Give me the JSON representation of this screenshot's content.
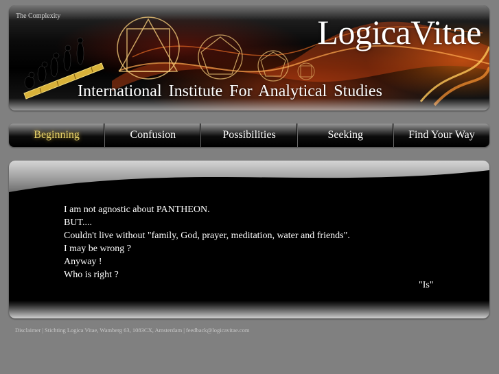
{
  "header": {
    "tagline": "The Complexity",
    "brand": "LogicaVitae",
    "institute": "International  Institute  For  Analytical  Studies"
  },
  "nav": {
    "items": [
      {
        "label": "Beginning",
        "active": true
      },
      {
        "label": "Confusion",
        "active": false
      },
      {
        "label": "Possibilities",
        "active": false
      },
      {
        "label": "Seeking",
        "active": false
      },
      {
        "label": "Find Your Way",
        "active": false
      }
    ]
  },
  "content": {
    "lines": [
      "I am not agnostic about PANTHEON.",
      "BUT....",
      "Couldn't live without \"family, God, prayer, meditation, water and friends\".",
      "I may be wrong ?",
      "Anyway !",
      "Who is right ?"
    ],
    "signature": "\"Is\""
  },
  "footer": {
    "disclaimer": "Disclaimer",
    "sep1": "|",
    "address": "Stichting Logica Vitae, Wamberg 63, 1083CX, Amsterdam",
    "sep2": "|",
    "email": "feedback@logicavitae.com"
  },
  "colors": {
    "page_background": "#808080",
    "active_nav": "#e8d36a",
    "panel_background": "#000000"
  },
  "icons": {
    "banner_art": "evolution-silhouettes-and-geometric-shapes"
  }
}
